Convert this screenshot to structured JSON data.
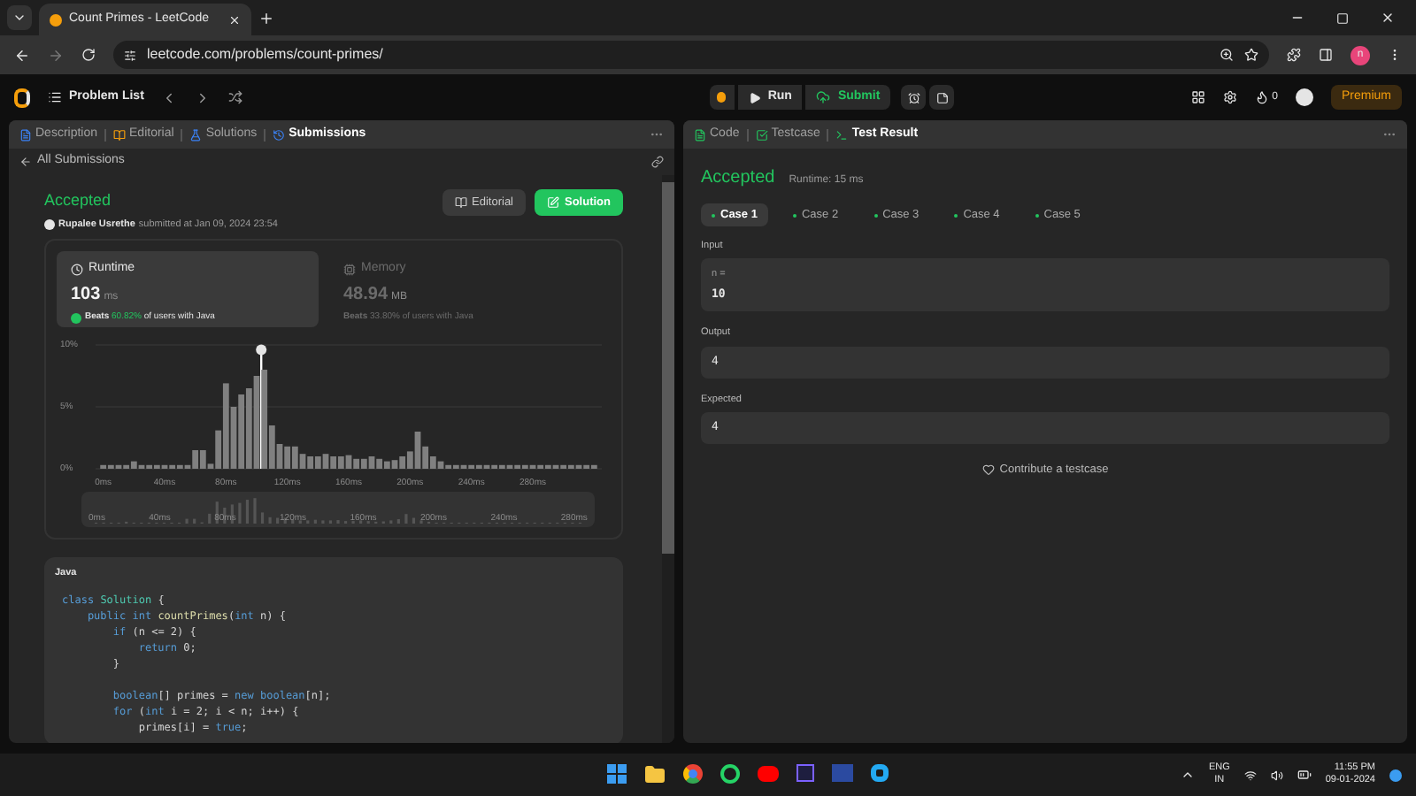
{
  "browser": {
    "tab_title": "Count Primes - LeetCode",
    "url": "leetcode.com/problems/count-primes/",
    "profile_initial": "n"
  },
  "header": {
    "problem_list": "Problem List",
    "run": "Run",
    "submit": "Submit",
    "streak": "0",
    "premium": "Premium"
  },
  "left_tabs": [
    {
      "label": "Description",
      "selected": false
    },
    {
      "label": "Editorial",
      "selected": false
    },
    {
      "label": "Solutions",
      "selected": false
    },
    {
      "label": "Submissions",
      "selected": true
    }
  ],
  "back_link": "All Submissions",
  "submission": {
    "status": "Accepted",
    "user": "Rupalee Usrethe",
    "submitted": "submitted at Jan 09, 2024 23:54",
    "editorial_button": "Editorial",
    "solution_button": "Solution"
  },
  "stats": [
    {
      "title": "Runtime",
      "value": "103",
      "unit": "ms",
      "beats_label": "Beats",
      "beats_pct": "60.82%",
      "beats_rest": "of users with Java",
      "selected": true
    },
    {
      "title": "Memory",
      "value": "48.94",
      "unit": "MB",
      "beats_label": "Beats",
      "beats_pct": "33.80%",
      "beats_rest": "of users with Java",
      "selected": false
    }
  ],
  "chart": {
    "chart_data": {
      "type": "bar",
      "x": [
        0,
        5,
        10,
        15,
        20,
        25,
        30,
        35,
        40,
        45,
        50,
        55,
        60,
        65,
        70,
        75,
        80,
        85,
        90,
        95,
        100,
        105,
        110,
        115,
        120,
        125,
        130,
        135,
        140,
        145,
        150,
        155,
        160,
        165,
        170,
        175,
        180,
        185,
        190,
        195,
        200,
        205,
        210,
        215,
        220,
        225,
        230,
        235,
        240,
        245,
        250,
        255,
        260,
        265,
        270,
        275,
        280,
        285,
        290,
        295,
        300,
        305,
        310,
        315,
        320
      ],
      "values": [
        0.3,
        0.3,
        0.3,
        0.3,
        0.6,
        0.3,
        0.3,
        0.3,
        0.3,
        0.3,
        0.3,
        0.3,
        1.5,
        1.5,
        0.4,
        3.1,
        6.9,
        5,
        6,
        6.5,
        7.5,
        8,
        3.5,
        2,
        1.8,
        1.8,
        1.2,
        1,
        1,
        1.2,
        1,
        1,
        1.1,
        0.8,
        0.8,
        1,
        0.8,
        0.6,
        0.7,
        1,
        1.4,
        3,
        1.8,
        1,
        0.6,
        0.3,
        0.3,
        0.3,
        0.3,
        0.3,
        0.3,
        0.3,
        0.3,
        0.3,
        0.3,
        0.3,
        0.3,
        0.3,
        0.3,
        0.3,
        0.3,
        0.3,
        0.3,
        0.3,
        0.3
      ],
      "ylim": [
        0,
        10
      ],
      "yticks": [
        {
          "value": 0,
          "label": "0%"
        },
        {
          "value": 5,
          "label": "5%"
        },
        {
          "value": 10,
          "label": "10%"
        }
      ],
      "xlim": [
        -5,
        325
      ],
      "xticks": [
        {
          "value": 0,
          "label": "0ms"
        },
        {
          "value": 40,
          "label": "40ms"
        },
        {
          "value": 80,
          "label": "80ms"
        },
        {
          "value": 120,
          "label": "120ms"
        },
        {
          "value": 160,
          "label": "160ms"
        },
        {
          "value": 200,
          "label": "200ms"
        },
        {
          "value": 240,
          "label": "240ms"
        },
        {
          "value": 280,
          "label": "280ms"
        }
      ]
    },
    "overview_labels": [
      "0ms",
      "40ms",
      "80ms",
      "120ms",
      "160ms",
      "200ms",
      "240ms",
      "280ms"
    ]
  },
  "code": {
    "language": "Java",
    "blocks": [
      [
        {
          "tokens": [
            {
              "text": "class ",
              "kind": "keyword"
            },
            {
              "text": "Solution",
              "kind": "class"
            },
            {
              "text": " {",
              "kind": "plain"
            }
          ]
        },
        {
          "tokens": [
            {
              "text": "    public int ",
              "kind": "keyword"
            },
            {
              "text": "countPrimes",
              "kind": "function"
            },
            {
              "text": "(",
              "kind": "plain"
            },
            {
              "text": "int ",
              "kind": "keyword"
            },
            {
              "text": "n) {",
              "kind": "plain"
            }
          ]
        },
        {
          "tokens": [
            {
              "text": "        if ",
              "kind": "keyword"
            },
            {
              "text": "(n <= 2) {",
              "kind": "plain"
            }
          ]
        },
        {
          "tokens": [
            {
              "text": "            return ",
              "kind": "keyword"
            },
            {
              "text": "0;",
              "kind": "plain"
            }
          ]
        },
        {
          "tokens": [
            {
              "text": "        }",
              "kind": "plain"
            }
          ]
        }
      ],
      [
        {
          "tokens": [
            {
              "text": "        boolean",
              "kind": "keyword"
            },
            {
              "text": "[] primes = ",
              "kind": "plain"
            },
            {
              "text": "new boolean",
              "kind": "keyword"
            },
            {
              "text": "[n];",
              "kind": "plain"
            }
          ]
        },
        {
          "tokens": [
            {
              "text": "        for ",
              "kind": "keyword"
            },
            {
              "text": "(",
              "kind": "plain"
            },
            {
              "text": "int ",
              "kind": "keyword"
            },
            {
              "text": "i = 2; i < n; i++) {",
              "kind": "plain"
            }
          ]
        },
        {
          "tokens": [
            {
              "text": "            primes[i] = ",
              "kind": "plain"
            },
            {
              "text": "true",
              "kind": "keyword"
            },
            {
              "text": ";",
              "kind": "plain"
            }
          ]
        }
      ]
    ]
  },
  "right_tabs": [
    {
      "label": "Code",
      "selected": false
    },
    {
      "label": "Testcase",
      "selected": false
    },
    {
      "label": "Test Result",
      "selected": true
    }
  ],
  "result": {
    "status": "Accepted",
    "runtime": "Runtime: 15 ms",
    "cases": [
      {
        "label": "Case 1",
        "selected": true
      },
      {
        "label": "Case 2",
        "selected": false
      },
      {
        "label": "Case 3",
        "selected": false
      },
      {
        "label": "Case 4",
        "selected": false
      },
      {
        "label": "Case 5",
        "selected": false
      }
    ],
    "input_label": "Input",
    "input_name": "n =",
    "input_value": "10",
    "output_label": "Output",
    "output_value": "4",
    "expected_label": "Expected",
    "expected_value": "4",
    "contribute": "Contribute a testcase"
  },
  "taskbar": {
    "lang": "ENG",
    "region": "IN",
    "time": "11:55 PM",
    "date": "09-01-2024"
  }
}
